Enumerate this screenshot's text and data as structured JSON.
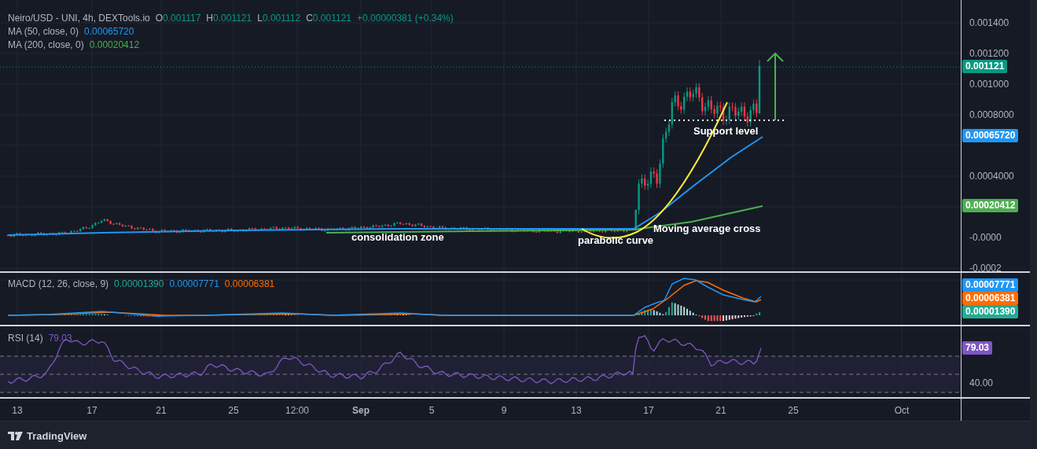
{
  "legend": {
    "symbol": "Neiro/USD - UNI, 4h, DEXTools.io",
    "ohlc": [
      {
        "label": "O",
        "value": "0.001117"
      },
      {
        "label": "H",
        "value": "0.001121"
      },
      {
        "label": "L",
        "value": "0.001112"
      },
      {
        "label": "C",
        "value": "0.001121"
      }
    ],
    "change": "+0.00000381 (+0.34%)"
  },
  "indicators": [
    {
      "name": "MA (50, close, 0)",
      "value": "0.00065720",
      "color": "#2196f3"
    },
    {
      "name": "MA (200, close, 0)",
      "value": "0.00020412",
      "color": "#4caf50"
    }
  ],
  "annotations": [
    {
      "text": "Support level"
    },
    {
      "text": "consolidation zone"
    },
    {
      "text": "Moving average cross"
    },
    {
      "text": "parabolic curve"
    }
  ],
  "price_axis": {
    "ticks": [
      "0.001400",
      "0.001200",
      "0.001000",
      "0.0008000",
      "0.0004000",
      "-0.0000",
      "-0.0002"
    ],
    "badges": [
      {
        "text": "0.001121",
        "color": "#089981"
      },
      {
        "text": "0.00065720",
        "color": "#2196f3"
      },
      {
        "text": "0.00020412",
        "color": "#4caf50"
      }
    ]
  },
  "macd": {
    "title": "MACD (12, 26, close, 9)",
    "values": [
      {
        "value": "0.00001390",
        "color": "#22ab94"
      },
      {
        "value": "0.00007771",
        "color": "#2196f3"
      },
      {
        "value": "0.00006381",
        "color": "#ff6d00"
      }
    ],
    "badges": [
      {
        "text": "0.00007771",
        "color": "#2196f3"
      },
      {
        "text": "0.00006381",
        "color": "#ff6d00"
      },
      {
        "text": "0.00001390",
        "color": "#22ab94"
      }
    ]
  },
  "rsi": {
    "title": "RSI (14)",
    "value": "79.03",
    "badge": "79.03",
    "ticks": [
      "40.00"
    ]
  },
  "time_axis": [
    {
      "label": "13",
      "major": false
    },
    {
      "label": "17",
      "major": false
    },
    {
      "label": "21",
      "major": false
    },
    {
      "label": "25",
      "major": false
    },
    {
      "label": "12:00",
      "major": false
    },
    {
      "label": "Sep",
      "major": true
    },
    {
      "label": "5",
      "major": false
    },
    {
      "label": "9",
      "major": false
    },
    {
      "label": "13",
      "major": false
    },
    {
      "label": "17",
      "major": false
    },
    {
      "label": "21",
      "major": false
    },
    {
      "label": "25",
      "major": false
    },
    {
      "label": "Oct",
      "major": false
    }
  ],
  "brand": "TradingView"
}
